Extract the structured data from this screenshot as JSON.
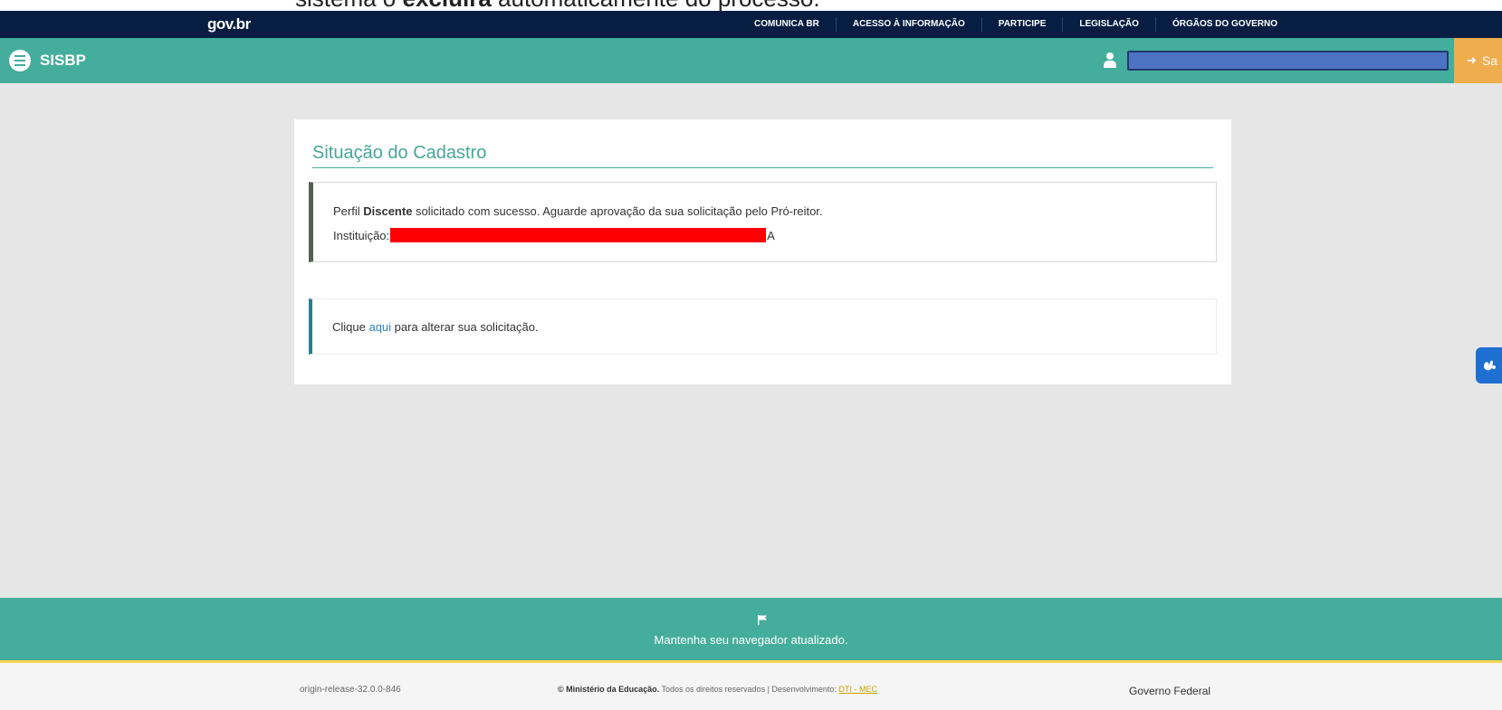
{
  "caption": {
    "prefix": "sistema o ",
    "bold": "excluirá",
    "suffix": " automaticamente do processo."
  },
  "gov_bar": {
    "logo": "gov.br",
    "nav": [
      "COMUNICA BR",
      "ACESSO À INFORMAÇÃO",
      "PARTICIPE",
      "LEGISLAÇÃO",
      "ÓRGÃOS DO GOVERNO"
    ]
  },
  "app_bar": {
    "title": "SISBP",
    "logout_label": "Sa"
  },
  "card": {
    "title": "Situação do Cadastro",
    "status": {
      "prefix": "Perfil ",
      "profile": "Discente",
      "suffix": " solicitado com sucesso. Aguarde aprovação da sua solicitação pelo Pró-reitor.",
      "institution_label": "Instituição:",
      "institution_tail": "A"
    },
    "edit": {
      "prefix": "Clique ",
      "link": "aqui",
      "suffix": " para alterar sua solicitação."
    }
  },
  "footer": {
    "notice": "Mantenha seu navegador atualizado.",
    "version": "origin-release-32.0.0-846",
    "copyright_org": "© Ministério da Educação.",
    "copyright_rest": " Todos os direitos reservados | Desenvolvimento: ",
    "dev_link": "DTI - MEC",
    "gov_federal": "Governo Federal"
  },
  "colors": {
    "gov_bar": "#071d41",
    "app_bar": "#45ad9c",
    "logout": "#f0ad4e",
    "accessibility": "#1f6fd1",
    "redaction": "#ff0000"
  }
}
